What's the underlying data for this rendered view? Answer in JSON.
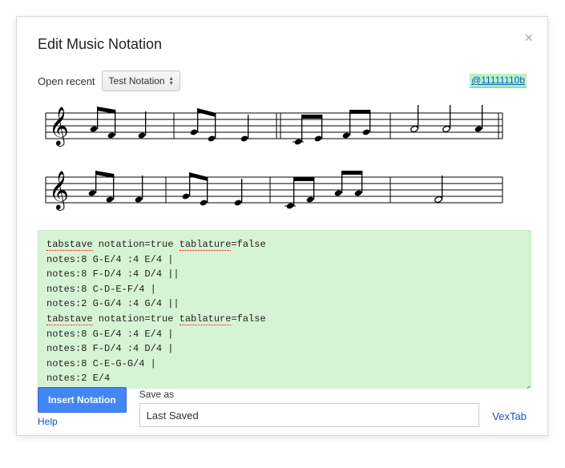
{
  "dialog": {
    "title": "Edit Music Notation",
    "close_icon": "×"
  },
  "toprow": {
    "open_recent_label": "Open recent",
    "recent_selected": "Test Notation",
    "user_link": "@11111110b"
  },
  "code": {
    "lines": [
      {
        "t": "kw",
        "v": "tabstave"
      },
      {
        "t": "txt",
        "v": " notation=true "
      },
      {
        "t": "kw",
        "v": "tablature"
      },
      {
        "t": "txt",
        "v": "=false"
      },
      {
        "t": "br"
      },
      {
        "t": "txt",
        "v": "notes:8 G-E/4 :4 E/4 |"
      },
      {
        "t": "br"
      },
      {
        "t": "txt",
        "v": "notes:8 F-D/4 :4 D/4 ||"
      },
      {
        "t": "br"
      },
      {
        "t": "txt",
        "v": "notes:8 C-D-E-F/4 |"
      },
      {
        "t": "br"
      },
      {
        "t": "txt",
        "v": "notes:2 G-G/4 :4 G/4 ||"
      },
      {
        "t": "br"
      },
      {
        "t": "kw",
        "v": "tabstave"
      },
      {
        "t": "txt",
        "v": " notation=true "
      },
      {
        "t": "kw",
        "v": "tablature"
      },
      {
        "t": "txt",
        "v": "=false"
      },
      {
        "t": "br"
      },
      {
        "t": "txt",
        "v": "notes:8 G-E/4 :4 E/4 |"
      },
      {
        "t": "br"
      },
      {
        "t": "txt",
        "v": "notes:8 F-D/4 :4 D/4 |"
      },
      {
        "t": "br"
      },
      {
        "t": "txt",
        "v": "notes:8 C-E-G-G/4 |"
      },
      {
        "t": "br"
      },
      {
        "t": "txt",
        "v": "notes:2 E/4"
      }
    ]
  },
  "bottom": {
    "insert_label": "Insert Notation",
    "help_label": "Help",
    "saveas_label": "Save as",
    "saveas_value": "Last Saved",
    "vextab_label": "VexTab"
  }
}
